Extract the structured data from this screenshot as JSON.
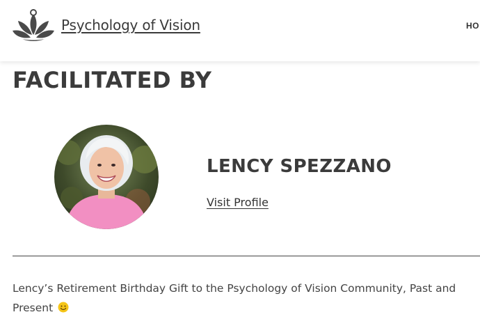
{
  "header": {
    "site_title": "Psychology of Vision",
    "logo_icon": "lotus-logo-icon",
    "nav": [
      {
        "label": "HO"
      }
    ]
  },
  "main": {
    "section_title": "FACILITATED BY",
    "facilitator": {
      "name": "LENCY SPEZZANO",
      "profile_link": "Visit Profile",
      "avatar_icon": "facilitator-photo"
    },
    "description": "Lency’s Retirement Birthday Gift to the Psychology of Vision Community, Past and Present",
    "emoji_icon": "smile-emoji-icon"
  },
  "colors": {
    "text": "#3b3b3b",
    "divider": "#444444",
    "avatar_top": "#d6dde0",
    "avatar_shirt": "#f28fc2",
    "emoji": "#f5c518"
  }
}
